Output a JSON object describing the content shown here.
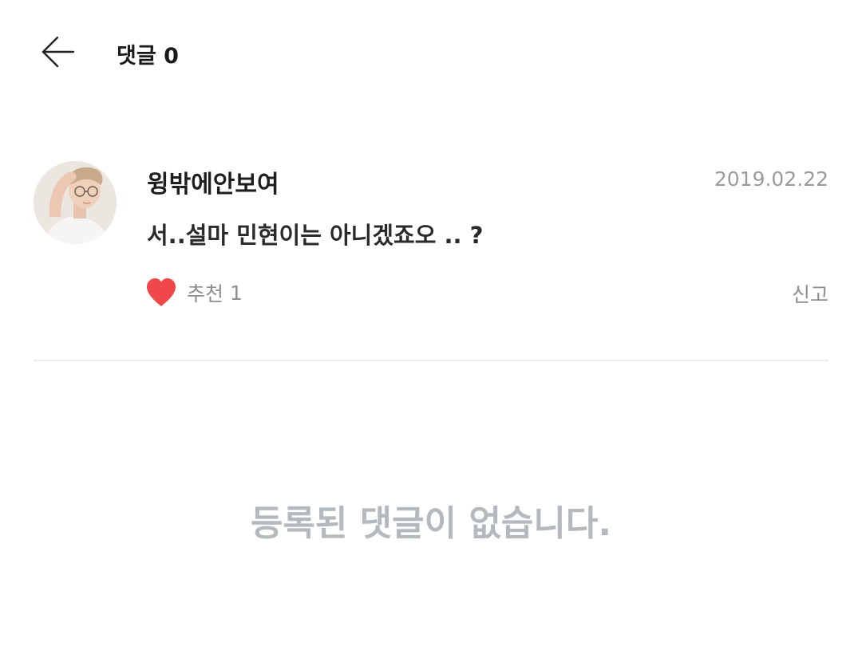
{
  "header": {
    "title": "댓글 0",
    "back_icon": "arrow-left-icon"
  },
  "comment": {
    "author": "윙밖에안보여",
    "date": "2019.02.22",
    "text": "서..설마 민현이는 아니겠죠오 .. ?",
    "avatar_icon": "profile-photo",
    "like_icon": "heart-icon",
    "like_color": "#f0474b",
    "like_label": "추천",
    "like_count": "1",
    "report_label": "신고"
  },
  "empty_state": {
    "message": "등록된 댓글이 없습니다."
  },
  "colors": {
    "muted_text": "#8e8e8e",
    "empty_text": "#b4b9bd",
    "divider": "#ececec"
  }
}
